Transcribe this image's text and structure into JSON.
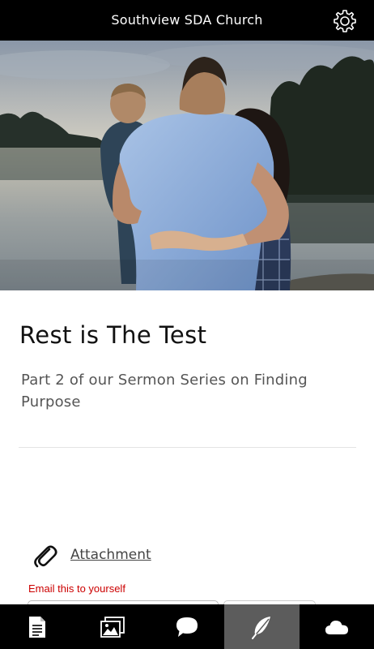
{
  "header": {
    "title": "Southview SDA Church",
    "settings_icon": "gear-icon"
  },
  "hero": {
    "image": "family-by-lake-photo"
  },
  "post": {
    "title": "Rest is The Test",
    "subtitle": "Part 2 of our Sermon Series on Finding Purpose"
  },
  "attachment": {
    "icon": "paperclip-icon",
    "label": "Attachment"
  },
  "email": {
    "label": "Email this to yourself",
    "value": "",
    "placeholder": ""
  },
  "bottom_nav": {
    "items": [
      {
        "icon": "document-icon",
        "active": false
      },
      {
        "icon": "gallery-icon",
        "active": false
      },
      {
        "icon": "chat-bubble-icon",
        "active": false
      },
      {
        "icon": "feather-icon",
        "active": true
      },
      {
        "icon": "cloud-icon",
        "active": false
      }
    ]
  },
  "colors": {
    "bar_background": "#000000",
    "active_tab": "#5c5c5c",
    "email_label": "#cc0000"
  }
}
